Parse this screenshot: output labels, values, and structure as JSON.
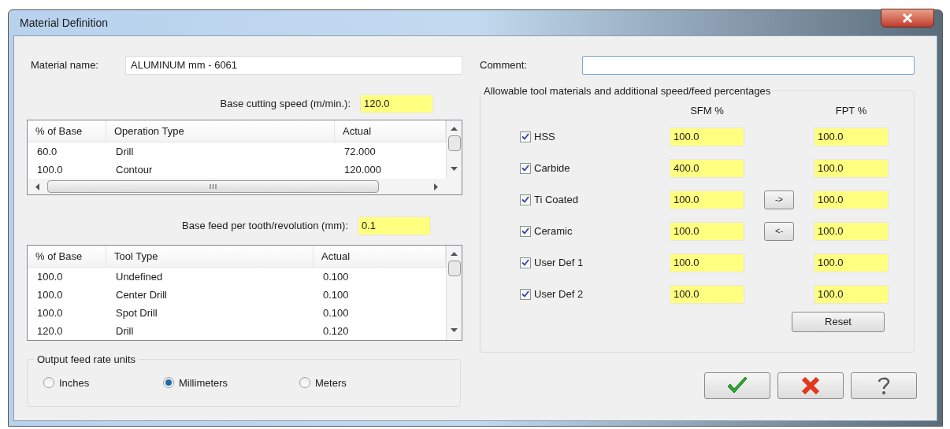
{
  "window": {
    "title": "Material Definition"
  },
  "material_name": {
    "label": "Material name:",
    "value": "ALUMINUM mm - 6061"
  },
  "comment": {
    "label": "Comment:"
  },
  "base_cutting_speed": {
    "label": "Base cutting speed (m/min.):",
    "value": "120.0"
  },
  "operations_table": {
    "columns": [
      "% of Base",
      "Operation Type",
      "Actual"
    ],
    "rows": [
      {
        "cells": [
          "60.0",
          "Drill",
          "72.000"
        ]
      },
      {
        "cells": [
          "100.0",
          "Contour",
          "120.000"
        ]
      }
    ]
  },
  "base_feed": {
    "label": "Base feed per tooth/revolution (mm):",
    "value": "0.1"
  },
  "tools_table": {
    "columns": [
      "% of Base",
      "Tool Type",
      "Actual"
    ],
    "rows": [
      {
        "cells": [
          "100.0",
          "Undefined",
          "0.100"
        ]
      },
      {
        "cells": [
          "100.0",
          "Center Drill",
          "0.100"
        ]
      },
      {
        "cells": [
          "100.0",
          "Spot Drill",
          "0.100"
        ]
      },
      {
        "cells": [
          "120.0",
          "Drill",
          "0.120"
        ]
      }
    ]
  },
  "output_units": {
    "title": "Output feed rate units",
    "options": [
      {
        "label": "Inches",
        "selected": false
      },
      {
        "label": "Millimeters",
        "selected": true
      },
      {
        "label": "Meters",
        "selected": false
      }
    ]
  },
  "tool_materials": {
    "title": "Allowable tool materials and additional speed/feed percentages",
    "columns": [
      "SFM %",
      "FPT %"
    ],
    "rows": [
      {
        "label": "HSS",
        "checked": true,
        "sfm": "100.0",
        "fpt": "100.0"
      },
      {
        "label": "Carbide",
        "checked": true,
        "sfm": "400.0",
        "fpt": "100.0"
      },
      {
        "label": "Ti Coated",
        "checked": true,
        "sfm": "100.0",
        "fpt": "100.0",
        "button": "->"
      },
      {
        "label": "Ceramic",
        "checked": true,
        "sfm": "100.0",
        "fpt": "100.0",
        "button": "<-"
      },
      {
        "label": "User Def 1",
        "checked": true,
        "sfm": "100.0",
        "fpt": "100.0"
      },
      {
        "label": "User Def 2",
        "checked": true,
        "sfm": "100.0",
        "fpt": "100.0"
      }
    ],
    "reset": "Reset"
  }
}
